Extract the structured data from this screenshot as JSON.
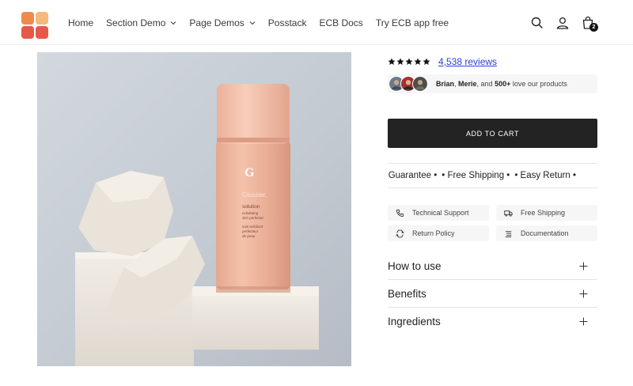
{
  "nav": {
    "items": [
      {
        "label": "Home",
        "has_dropdown": false
      },
      {
        "label": "Section Demo",
        "has_dropdown": true
      },
      {
        "label": "Page Demos",
        "has_dropdown": true
      },
      {
        "label": "Posstack",
        "has_dropdown": false
      },
      {
        "label": "ECB Docs",
        "has_dropdown": false
      },
      {
        "label": "Try ECB app free",
        "has_dropdown": false
      }
    ]
  },
  "header": {
    "icons": [
      "search-icon",
      "account-icon",
      "cart-icon"
    ],
    "cart_count": "2"
  },
  "product": {
    "image_icon": "glossier-solution-bottle-photo",
    "bottle_text": {
      "brand": "Glossier.",
      "name": "solution",
      "desc1": "exfoliating",
      "desc2": "skin perfector",
      "fr1": "soin exfoliant",
      "fr2": "perfecteur",
      "fr3": "de peau"
    },
    "rating": 5,
    "reviews_label": "4,538 reviews",
    "social_proof": {
      "name1": "Brian",
      "sep1": ", ",
      "name2": "Merie",
      "sep2": ", and ",
      "count": "500+",
      "suffix": " love our products"
    },
    "add_to_cart_label": "ADD TO CART",
    "marquee": [
      "ck Guarantee •",
      "• Free Shipping •",
      "• Easy Return •"
    ],
    "features": [
      {
        "icon": "phone-icon",
        "label": "Technical Support"
      },
      {
        "icon": "truck-icon",
        "label": "Free Shipping"
      },
      {
        "icon": "return-icon",
        "label": "Return Policy"
      },
      {
        "icon": "document-icon",
        "label": "Documentation"
      }
    ],
    "accordions": [
      "How to use",
      "Benefits",
      "Ingredients"
    ]
  },
  "colors": {
    "accent_link": "#2b3fcf",
    "button_bg": "#232323",
    "logo_orange": "#f08a4b",
    "logo_red": "#e8574a",
    "logo_peach": "#f5b97b"
  }
}
